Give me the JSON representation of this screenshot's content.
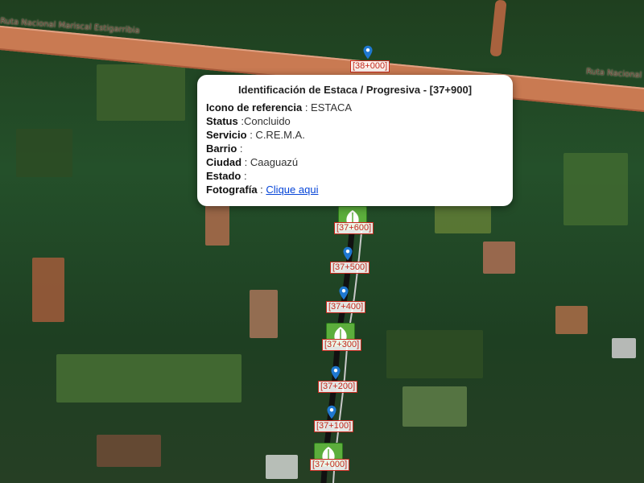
{
  "map": {
    "roads": {
      "highway_left_label": "Ruta Nacional Mariscal Estigarribia",
      "highway_right_label": "Ruta Nacional"
    },
    "markers": [
      {
        "type": "pin",
        "label": "[38+000]"
      },
      {
        "type": "icon",
        "label": "[37+600]"
      },
      {
        "type": "pin",
        "label": "[37+500]"
      },
      {
        "type": "pin",
        "label": "[37+400]"
      },
      {
        "type": "icon",
        "label": "[37+300]"
      },
      {
        "type": "pin",
        "label": "[37+200]"
      },
      {
        "type": "pin",
        "label": "[37+100]"
      },
      {
        "type": "icon",
        "label": "[37+000]"
      }
    ]
  },
  "popup": {
    "title": "Identificación de Estaca / Progresiva - [37+900]",
    "rows": [
      {
        "label": "Icono de referencia",
        "sep": " : ",
        "value": "ESTACA"
      },
      {
        "label": "Status",
        "sep": " :",
        "value": "Concluido"
      },
      {
        "label": "Servicio",
        "sep": " : ",
        "value": "C.RE.M.A."
      },
      {
        "label": "Barrio",
        "sep": " : ",
        "value": ""
      },
      {
        "label": "Ciudad",
        "sep": " : ",
        "value": "Caaguazú"
      },
      {
        "label": "Estado",
        "sep": " : ",
        "value": ""
      }
    ],
    "photo": {
      "label": "Fotografía",
      "sep": " : ",
      "link_text": "Clique aqui"
    }
  },
  "colors": {
    "marker_label": "#c62a1e",
    "pin": "#1f78d1",
    "km_icon": "#5cae3c",
    "highway": "#c97a52",
    "route": "#111111",
    "link": "#0645d8"
  },
  "icons": {
    "pin": "map-pin-icon",
    "km": "leaf-marker-icon"
  }
}
